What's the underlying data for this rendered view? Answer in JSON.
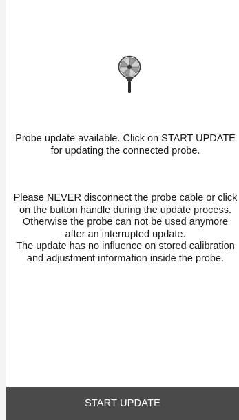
{
  "icons": {
    "probe": "probe-fan-icon"
  },
  "messages": {
    "available": [
      "Probe update available. Click on START UPDATE",
      "for updating the connected probe."
    ],
    "warning": [
      "Please NEVER disconnect the probe cable or click",
      "on the button handle during the update process.",
      "Otherwise the probe can not be used anymore",
      "after an interrupted update.",
      "The update has no influence on stored calibration",
      "and adjustment information inside the probe."
    ]
  },
  "action": {
    "label": "START UPDATE"
  },
  "colors": {
    "action_bar": "#4a4a4a",
    "action_text": "#ffffff",
    "background": "#ffffff"
  }
}
